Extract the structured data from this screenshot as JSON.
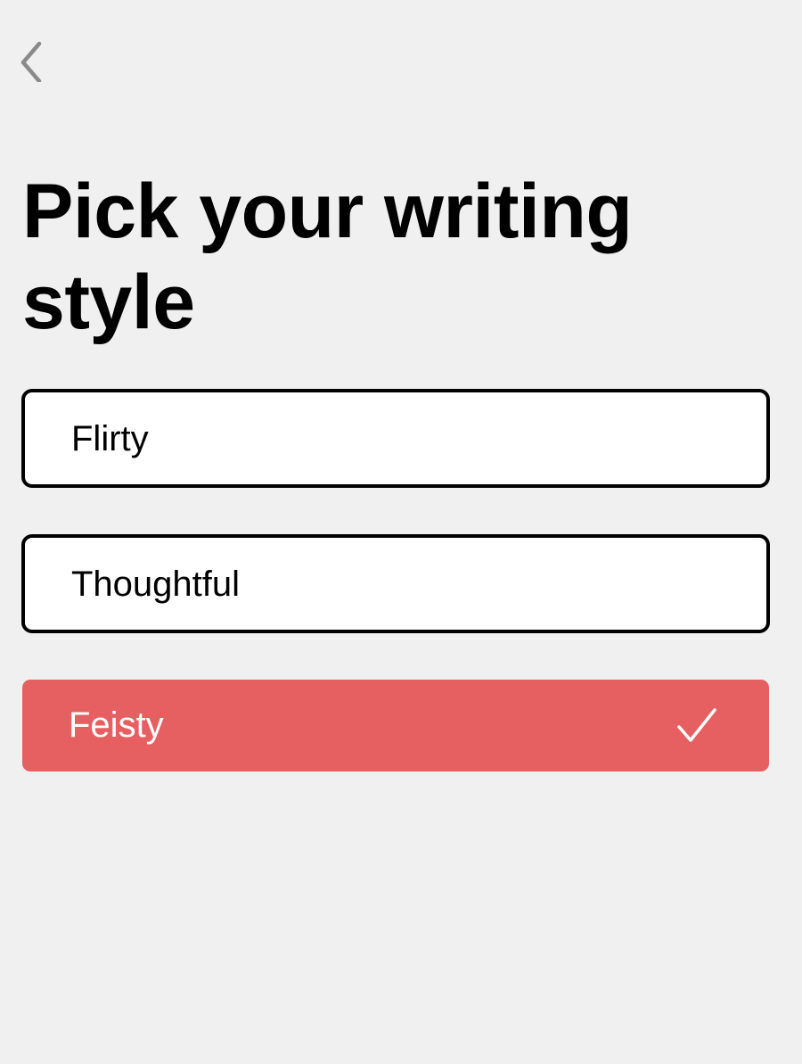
{
  "header": {
    "back_icon": "chevron-left-icon",
    "back_icon_color": "#8a8a8a"
  },
  "page": {
    "title": "Pick your writing style",
    "background_color": "#f1f0f1"
  },
  "options": [
    {
      "label": "Flirty",
      "selected": false
    },
    {
      "label": "Thoughtful",
      "selected": false
    },
    {
      "label": "Feisty",
      "selected": true
    }
  ],
  "colors": {
    "selected_background": "#e66061",
    "option_border": "#000000",
    "option_background": "#ffffff",
    "selected_text": "#ffffff"
  },
  "selected_indicator_icon": "check-icon"
}
